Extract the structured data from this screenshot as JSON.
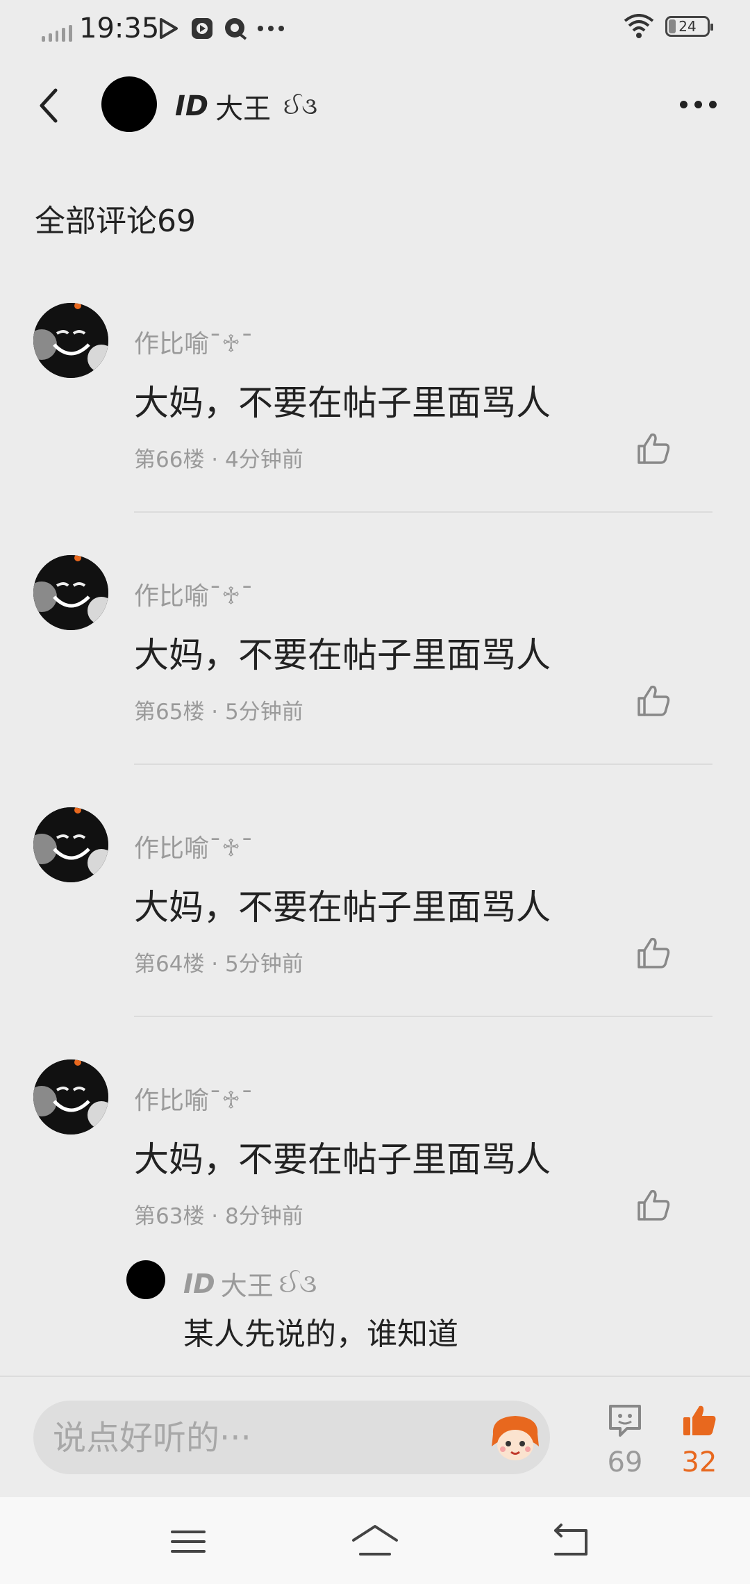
{
  "status_bar": {
    "time": "19:35",
    "battery": "24"
  },
  "header": {
    "user_id_part": "ID",
    "user_name_part": "大王",
    "user_deco": "ઈ૩",
    "more_icon": "more-dots-icon",
    "back_icon": "back-arrow-icon"
  },
  "comments_section": {
    "title": "全部评论69"
  },
  "comments": [
    {
      "author": "作比喻ˉ♱ˉ",
      "text": "大妈，不要在帖子里面骂人",
      "meta": "第66楼 · 4分钟前"
    },
    {
      "author": "作比喻ˉ♱ˉ",
      "text": "大妈，不要在帖子里面骂人",
      "meta": "第65楼 · 5分钟前"
    },
    {
      "author": "作比喻ˉ♱ˉ",
      "text": "大妈，不要在帖子里面骂人",
      "meta": "第64楼 · 5分钟前"
    },
    {
      "author": "作比喻ˉ♱ˉ",
      "text": "大妈，不要在帖子里面骂人",
      "meta": "第63楼 · 8分钟前"
    }
  ],
  "reply": {
    "author_id": "ID",
    "author_name": "大王",
    "author_deco": "ઈ૩",
    "text": "某人先说的，谁知道"
  },
  "bottom_bar": {
    "input_placeholder": "说点好听的···",
    "comment_count": "69",
    "like_count": "32",
    "accent_color": "#e8681e"
  }
}
